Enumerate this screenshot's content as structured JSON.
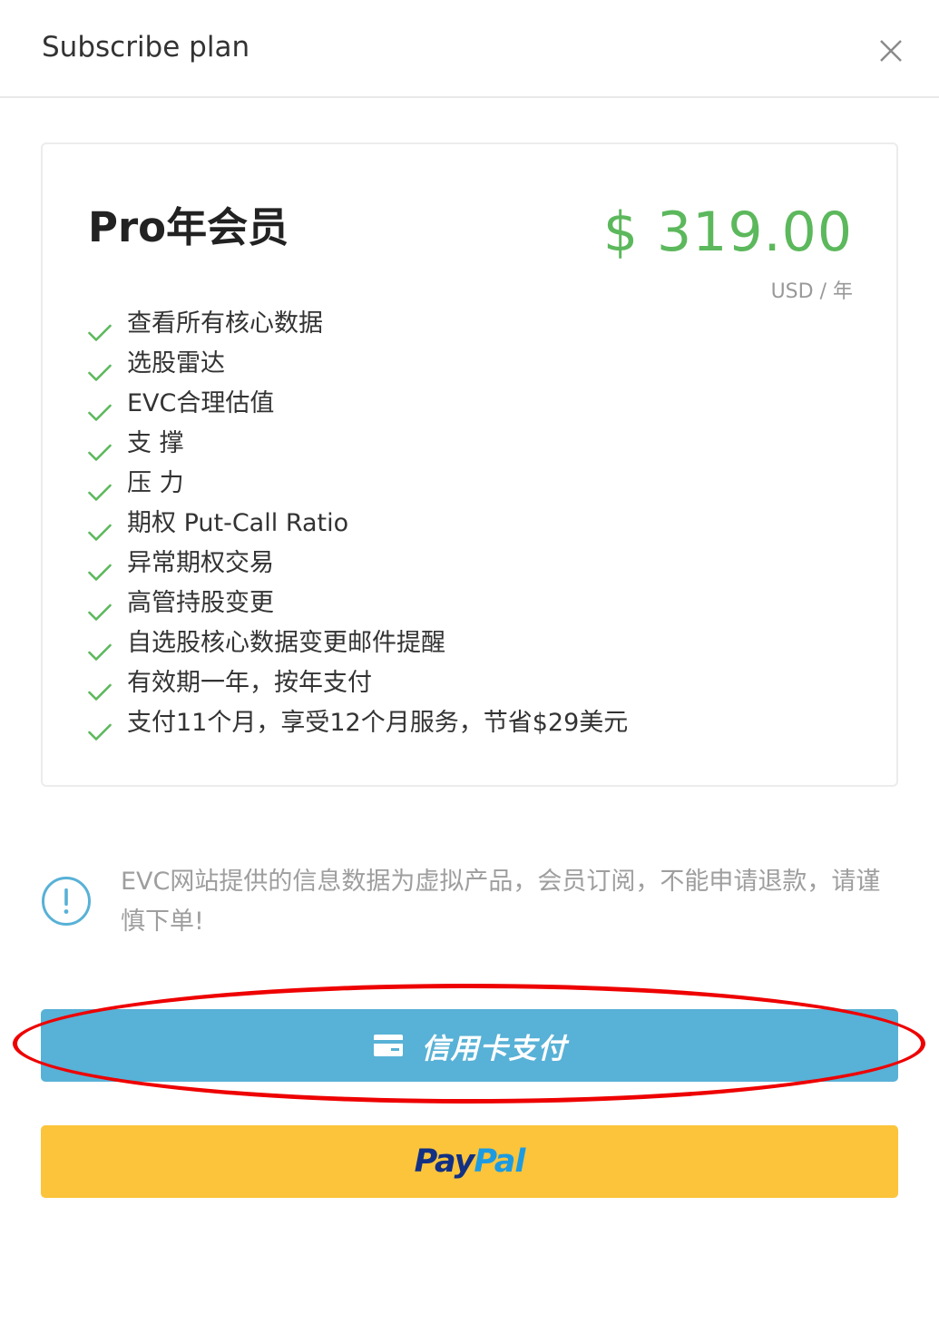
{
  "header": {
    "title": "Subscribe plan",
    "close_icon": "close-icon"
  },
  "plan": {
    "name": "Pro年会员",
    "price": "$ 319.00",
    "price_unit": "USD / 年",
    "price_color": "#5cb85c",
    "check_color": "#5cb85c",
    "features": [
      "查看所有核心数据",
      "选股雷达",
      "EVC合理估值",
      "支 撑",
      "压 力",
      "期权 Put-Call Ratio",
      "异常期权交易",
      "高管持股变更",
      "自选股核心数据变更邮件提醒",
      "有效期一年，按年支付",
      "支付11个月，享受12个月服务，节省$29美元"
    ]
  },
  "notice": {
    "icon": "info-icon",
    "text": "EVC网站提供的信息数据为虚拟产品，会员订阅，不能申请退款，请谨慎下单!"
  },
  "buttons": {
    "credit_card": {
      "label": "信用卡支付",
      "icon": "credit-card-icon",
      "color": "#58b1d6"
    },
    "paypal": {
      "logo_part1": "Pay",
      "logo_part2": "Pal",
      "color": "#fbc43b"
    }
  },
  "annotation": {
    "highlight_color": "#ee0000"
  }
}
